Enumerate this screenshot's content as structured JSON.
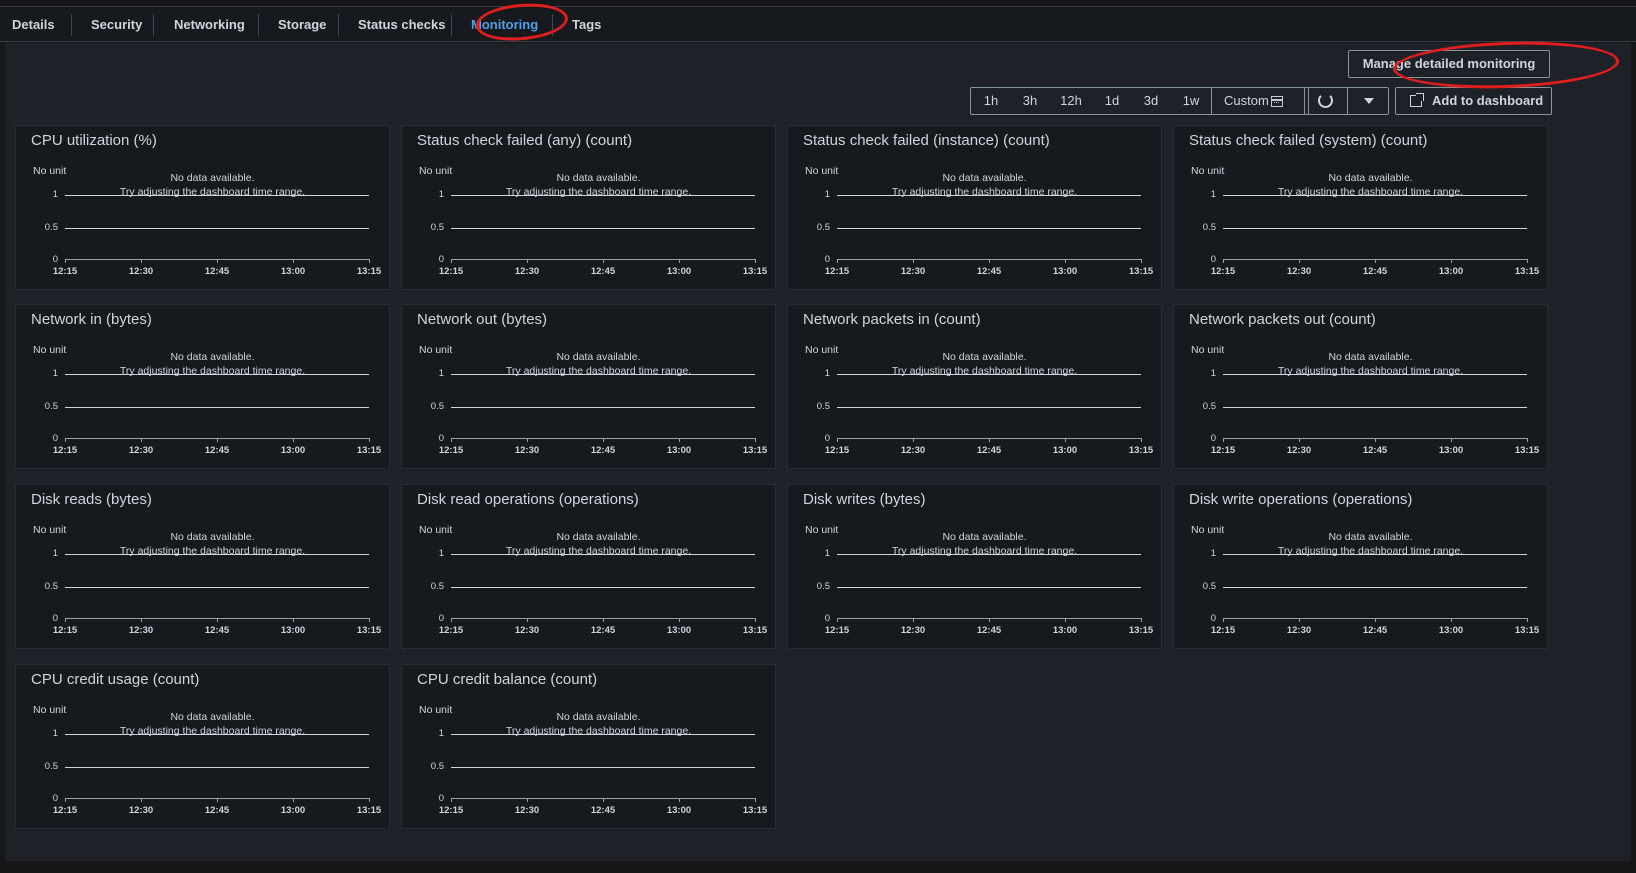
{
  "tabs": [
    {
      "label": "Details",
      "name": "tab-details",
      "active": false
    },
    {
      "label": "Security",
      "name": "tab-security",
      "active": false
    },
    {
      "label": "Networking",
      "name": "tab-networking",
      "active": false
    },
    {
      "label": "Storage",
      "name": "tab-storage",
      "active": false
    },
    {
      "label": "Status checks",
      "name": "tab-status-checks",
      "active": false
    },
    {
      "label": "Monitoring",
      "name": "tab-monitoring",
      "active": true
    },
    {
      "label": "Tags",
      "name": "tab-tags",
      "active": false
    }
  ],
  "toolbar": {
    "manage_label": "Manage detailed monitoring",
    "ranges": [
      "1h",
      "3h",
      "12h",
      "1d",
      "3d",
      "1w"
    ],
    "custom_label": "Custom",
    "add_dashboard_label": "Add to dashboard"
  },
  "chart_common": {
    "unit_label": "No unit",
    "no_data_line1": "No data available.",
    "no_data_line2": "Try adjusting the dashboard time range.",
    "y_ticks": [
      "1",
      "0.5",
      "0"
    ],
    "x_ticks": [
      "12:15",
      "12:30",
      "12:45",
      "13:00",
      "13:15"
    ]
  },
  "widgets": [
    {
      "title": "CPU utilization (%)"
    },
    {
      "title": "Status check failed (any) (count)"
    },
    {
      "title": "Status check failed (instance) (count)"
    },
    {
      "title": "Status check failed (system) (count)"
    },
    {
      "title": "Network in (bytes)"
    },
    {
      "title": "Network out (bytes)"
    },
    {
      "title": "Network packets in (count)"
    },
    {
      "title": "Network packets out (count)"
    },
    {
      "title": "Disk reads (bytes)"
    },
    {
      "title": "Disk read operations (operations)"
    },
    {
      "title": "Disk writes (bytes)"
    },
    {
      "title": "Disk write operations (operations)"
    },
    {
      "title": "CPU credit usage (count)"
    },
    {
      "title": "CPU credit balance (count)"
    }
  ],
  "colors": {
    "accent": "#539fe5",
    "annotation": "#e01e1e",
    "background": "#161719",
    "panel": "#1e2228"
  }
}
